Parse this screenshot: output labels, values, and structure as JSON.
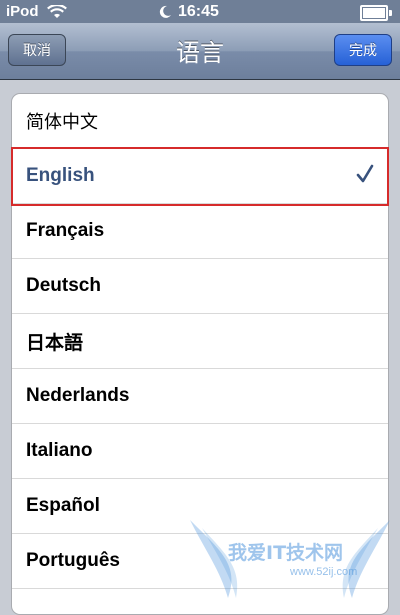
{
  "status_bar": {
    "carrier": "iPod",
    "time": "16:45",
    "icons": [
      "wifi-icon",
      "moon-icon",
      "battery-icon"
    ],
    "battery_level": 1.0
  },
  "nav_bar": {
    "title": "语言",
    "cancel_label": "取消",
    "done_label": "完成"
  },
  "languages": {
    "items": [
      {
        "label": "简体中文",
        "selected": false
      },
      {
        "label": "English",
        "selected": true
      },
      {
        "label": "Français",
        "selected": false
      },
      {
        "label": "Deutsch",
        "selected": false
      },
      {
        "label": "日本語",
        "selected": false
      },
      {
        "label": "Nederlands",
        "selected": false
      },
      {
        "label": "Italiano",
        "selected": false
      },
      {
        "label": "Español",
        "selected": false
      },
      {
        "label": "Português",
        "selected": false
      }
    ],
    "check_icon": "checkmark-icon"
  },
  "watermark": {
    "text": "我爱IT技术网",
    "url": "www.52ij.com"
  },
  "colors": {
    "nav_bar": "#7a8ca9",
    "done_button": "#2f6be0",
    "selected_text": "#38527d",
    "highlight": "#d62b2b",
    "checkmark": "#38527d"
  }
}
